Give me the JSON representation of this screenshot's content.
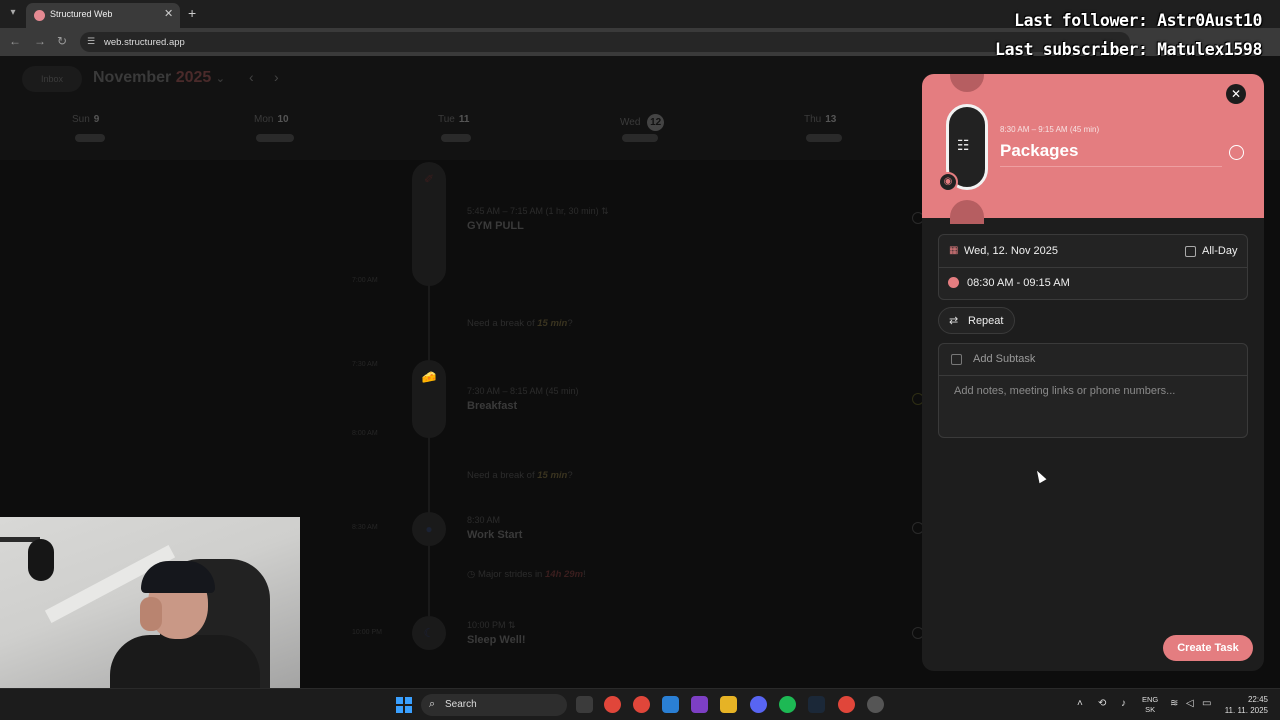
{
  "browser": {
    "tab_title": "Structured Web",
    "tab_menu_icon": "chevron-down-icon",
    "new_tab_icon": "plus-icon",
    "url": "web.structured.app"
  },
  "overlay": {
    "last_follower": "Last follower: Astr0Aust10",
    "last_subscriber": "Last subscriber: Matulex1598"
  },
  "calendar": {
    "inbox_label": "Inbox",
    "month": "November",
    "year": "2025",
    "days": [
      {
        "name": "Sun",
        "num": "9"
      },
      {
        "name": "Mon",
        "num": "10"
      },
      {
        "name": "Tue",
        "num": "11"
      },
      {
        "name": "Wed",
        "num": "12"
      },
      {
        "name": "Thu",
        "num": "13"
      }
    ],
    "events": [
      {
        "time": "5:45 AM – 7:15 AM (1 hr, 30 min) ⇅",
        "title": "GYM PULL"
      },
      {
        "time": "7:30 AM – 8:15 AM (45 min)",
        "title": "Breakfast"
      },
      {
        "time": "8:30 AM",
        "title": "Work Start"
      },
      {
        "time": "10:00 PM ⇅",
        "title": "Sleep Well!"
      }
    ],
    "breaks": [
      {
        "text": "Need a break of ",
        "value": "15 min",
        "suffix": "?"
      },
      {
        "text": "Need a break of ",
        "value": "15 min",
        "suffix": "?"
      }
    ],
    "major_strides": {
      "text": "Major strides in ",
      "value": "14h 29m",
      "suffix": "!"
    },
    "time_labels": [
      "7:00 AM",
      "7:30 AM",
      "8:00 AM",
      "8:30 AM",
      "10:00 PM"
    ]
  },
  "task_panel": {
    "time_range": "8:30 AM – 9:15 AM  (45 min)",
    "title": "Packages",
    "date": "Wed, 12. Nov 2025",
    "all_day_label": "All-Day",
    "time": "08:30 AM - 09:15 AM",
    "repeat_label": "Repeat",
    "subtask_label": "Add Subtask",
    "notes_placeholder": "Add notes, meeting links or phone numbers...",
    "create_label": "Create Task",
    "accent_color": "#e47d80"
  },
  "taskbar": {
    "search_label": "Search",
    "lang_top": "ENG",
    "lang_bottom": "SK",
    "time": "22:45",
    "date": "11. 11. 2025"
  }
}
